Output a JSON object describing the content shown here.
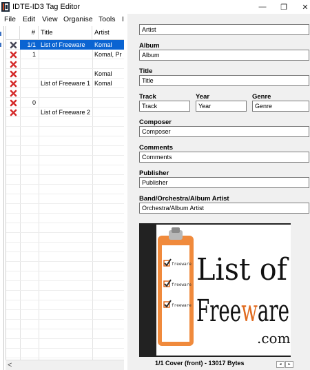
{
  "window": {
    "title": "IDTE-ID3 Tag Editor",
    "minimize_glyph": "—",
    "maximize_glyph": "❐",
    "close_glyph": "✕"
  },
  "menu": [
    "File",
    "Edit",
    "View",
    "Organise",
    "Tools",
    "I"
  ],
  "track_list": {
    "columns": {
      "num": "#",
      "title": "Title",
      "artist": "Artist"
    },
    "rows": [
      {
        "num": "1/1",
        "title": "List of Freeware",
        "artist": "Komal",
        "selected": true,
        "icon": "remove-x-icon"
      },
      {
        "num": "1",
        "title": "",
        "artist": "Komal, Pr",
        "selected": false,
        "icon": "remove-x-icon"
      },
      {
        "num": "",
        "title": "",
        "artist": "",
        "selected": false,
        "icon": "remove-x-icon"
      },
      {
        "num": "",
        "title": "",
        "artist": "Komal",
        "selected": false,
        "icon": "remove-x-icon"
      },
      {
        "num": "",
        "title": "List of Freeware 1",
        "artist": "Komal",
        "selected": false,
        "icon": "remove-x-icon"
      },
      {
        "num": "",
        "title": "",
        "artist": "",
        "selected": false,
        "icon": "remove-x-icon"
      },
      {
        "num": "0",
        "title": "",
        "artist": "",
        "selected": false,
        "icon": "remove-x-icon"
      },
      {
        "num": "",
        "title": "List of Freeware 2",
        "artist": "",
        "selected": false,
        "icon": "remove-x-icon"
      }
    ],
    "scroll_left_glyph": "<"
  },
  "tag_form": {
    "artist_value": "Artist",
    "album_label": "Album",
    "album_value": "Album",
    "title_label": "Title",
    "title_value": "Title",
    "track_label": "Track",
    "track_value": "Track",
    "year_label": "Year",
    "year_value": "Year",
    "genre_label": "Genre",
    "genre_value": "Genre",
    "composer_label": "Composer",
    "composer_value": "Composer",
    "comments_label": "Comments",
    "comments_value": "Comments",
    "publisher_label": "Publisher",
    "publisher_value": "Publisher",
    "band_label": "Band/Orchestra/Album Artist",
    "band_value": "Orchestra/Album Artist"
  },
  "cover": {
    "logo_line1": "List of",
    "logo_line2_pre": "Free",
    "logo_line2_accent": "w",
    "logo_line2_post": "are",
    "logo_line3": ".com",
    "checklist_label": "freeware",
    "caption": "1/1 Cover (front) - 13017 Bytes",
    "prev_glyph": "◂",
    "next_glyph": "▸",
    "accent_color": "#e06a1e"
  }
}
